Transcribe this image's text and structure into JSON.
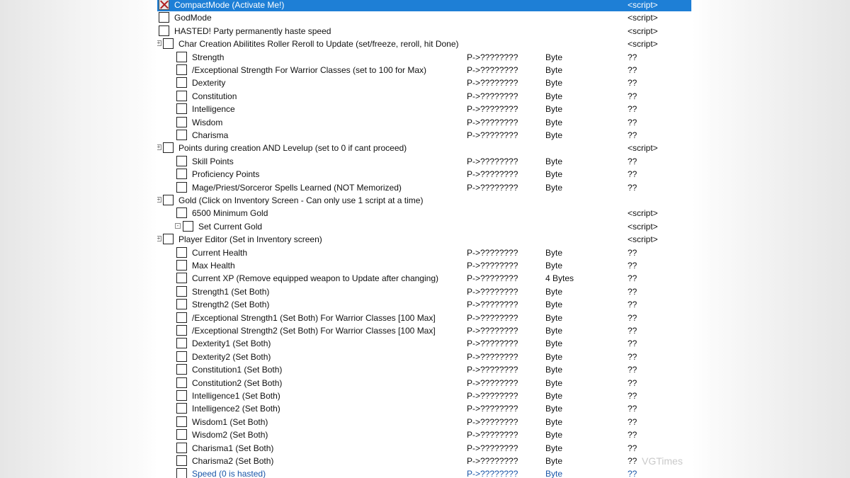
{
  "watermark": "VGTimes",
  "rows": [
    {
      "desc": "CompactMode (Activate  Me!)",
      "level": 0,
      "expander": "",
      "checked": true,
      "selected": true,
      "address": "",
      "type": "",
      "value": "<script>"
    },
    {
      "desc": "GodMode",
      "level": 0,
      "expander": "",
      "checked": false,
      "address": "",
      "type": "",
      "value": "<script>"
    },
    {
      "desc": "HASTED! Party permanently haste speed",
      "level": 0,
      "expander": "",
      "checked": false,
      "address": "",
      "type": "",
      "value": "<script>"
    },
    {
      "desc": "Char Creation Abilitites Roller Reroll to Update (set/freeze, reroll, hit Done)",
      "level": 1,
      "expander": "+",
      "checked": false,
      "address": "",
      "type": "",
      "value": "<script>"
    },
    {
      "desc": "Strength",
      "level": 2,
      "expander": "",
      "checked": false,
      "address": "P->????????",
      "type": "Byte",
      "value": "??"
    },
    {
      "desc": "/Exceptional Strength For Warrior Classes (set to 100 for Max)",
      "level": 2,
      "expander": "",
      "checked": false,
      "address": "P->????????",
      "type": "Byte",
      "value": "??"
    },
    {
      "desc": "Dexterity",
      "level": 2,
      "expander": "",
      "checked": false,
      "address": "P->????????",
      "type": "Byte",
      "value": "??"
    },
    {
      "desc": "Constitution",
      "level": 2,
      "expander": "",
      "checked": false,
      "address": "P->????????",
      "type": "Byte",
      "value": "??"
    },
    {
      "desc": "Intelligence",
      "level": 2,
      "expander": "",
      "checked": false,
      "address": "P->????????",
      "type": "Byte",
      "value": "??"
    },
    {
      "desc": "Wisdom",
      "level": 2,
      "expander": "",
      "checked": false,
      "address": "P->????????",
      "type": "Byte",
      "value": "??"
    },
    {
      "desc": "Charisma",
      "level": 2,
      "expander": "",
      "checked": false,
      "address": "P->????????",
      "type": "Byte",
      "value": "??"
    },
    {
      "desc": "Points during creation AND Levelup (set to 0 if cant proceed)",
      "level": 1,
      "expander": "+",
      "checked": false,
      "address": "",
      "type": "",
      "value": "<script>"
    },
    {
      "desc": "Skill Points",
      "level": 2,
      "expander": "",
      "checked": false,
      "address": "P->????????",
      "type": "Byte",
      "value": "??"
    },
    {
      "desc": "Proficiency Points",
      "level": 2,
      "expander": "",
      "checked": false,
      "address": "P->????????",
      "type": "Byte",
      "value": "??"
    },
    {
      "desc": "Mage/Priest/Sorceror Spells Learned (NOT Memorized)",
      "level": 2,
      "expander": "",
      "checked": false,
      "address": "P->????????",
      "type": "Byte",
      "value": "??"
    },
    {
      "desc": "Gold (Click on Inventory Screen - Can only use 1 script at a time)",
      "level": 1,
      "expander": "+",
      "checked": false,
      "address": "",
      "type": "",
      "value": ""
    },
    {
      "desc": "6500 Minimum Gold",
      "level": 2,
      "expander": "",
      "checked": false,
      "address": "",
      "type": "",
      "value": "<script>"
    },
    {
      "desc": "Set Current Gold",
      "level": 3,
      "expander": "-",
      "checked": false,
      "address": "",
      "type": "",
      "value": "<script>"
    },
    {
      "desc": "Player Editor (Set in Inventory screen)",
      "level": 1,
      "expander": "+",
      "checked": false,
      "address": "",
      "type": "",
      "value": "<script>"
    },
    {
      "desc": "Current Health",
      "level": 2,
      "expander": "",
      "checked": false,
      "address": "P->????????",
      "type": "Byte",
      "value": "??"
    },
    {
      "desc": "Max Health",
      "level": 2,
      "expander": "",
      "checked": false,
      "address": "P->????????",
      "type": "Byte",
      "value": "??"
    },
    {
      "desc": "Current XP (Remove equipped weapon to Update after changing)",
      "level": 2,
      "expander": "",
      "checked": false,
      "address": "P->????????",
      "type": "4 Bytes",
      "value": "??"
    },
    {
      "desc": "Strength1 (Set Both)",
      "level": 2,
      "expander": "",
      "checked": false,
      "address": "P->????????",
      "type": "Byte",
      "value": "??"
    },
    {
      "desc": "Strength2 (Set Both)",
      "level": 2,
      "expander": "",
      "checked": false,
      "address": "P->????????",
      "type": "Byte",
      "value": "??"
    },
    {
      "desc": "/Exceptional Strength1 (Set Both) For Warrior Classes [100 Max]",
      "level": 2,
      "expander": "",
      "checked": false,
      "address": "P->????????",
      "type": "Byte",
      "value": "??"
    },
    {
      "desc": "/Exceptional Strength2 (Set Both) For Warrior Classes [100 Max]",
      "level": 2,
      "expander": "",
      "checked": false,
      "address": "P->????????",
      "type": "Byte",
      "value": "??"
    },
    {
      "desc": "Dexterity1 (Set Both)",
      "level": 2,
      "expander": "",
      "checked": false,
      "address": "P->????????",
      "type": "Byte",
      "value": "??"
    },
    {
      "desc": "Dexterity2 (Set Both)",
      "level": 2,
      "expander": "",
      "checked": false,
      "address": "P->????????",
      "type": "Byte",
      "value": "??"
    },
    {
      "desc": "Constitution1 (Set Both)",
      "level": 2,
      "expander": "",
      "checked": false,
      "address": "P->????????",
      "type": "Byte",
      "value": "??"
    },
    {
      "desc": "Constitution2 (Set Both)",
      "level": 2,
      "expander": "",
      "checked": false,
      "address": "P->????????",
      "type": "Byte",
      "value": "??"
    },
    {
      "desc": "Intelligence1 (Set Both)",
      "level": 2,
      "expander": "",
      "checked": false,
      "address": "P->????????",
      "type": "Byte",
      "value": "??"
    },
    {
      "desc": "Intelligence2 (Set Both)",
      "level": 2,
      "expander": "",
      "checked": false,
      "address": "P->????????",
      "type": "Byte",
      "value": "??"
    },
    {
      "desc": "Wisdom1 (Set Both)",
      "level": 2,
      "expander": "",
      "checked": false,
      "address": "P->????????",
      "type": "Byte",
      "value": "??"
    },
    {
      "desc": "Wisdom2 (Set Both)",
      "level": 2,
      "expander": "",
      "checked": false,
      "address": "P->????????",
      "type": "Byte",
      "value": "??"
    },
    {
      "desc": "Charisma1 (Set Both)",
      "level": 2,
      "expander": "",
      "checked": false,
      "address": "P->????????",
      "type": "Byte",
      "value": "??"
    },
    {
      "desc": "Charisma2 (Set Both)",
      "level": 2,
      "expander": "",
      "checked": false,
      "address": "P->????????",
      "type": "Byte",
      "value": "??"
    },
    {
      "desc": "Speed (0 is hasted)",
      "level": 2,
      "expander": "",
      "checked": false,
      "partial": true,
      "address": "P->????????",
      "type": "Byte",
      "value": "??"
    }
  ]
}
